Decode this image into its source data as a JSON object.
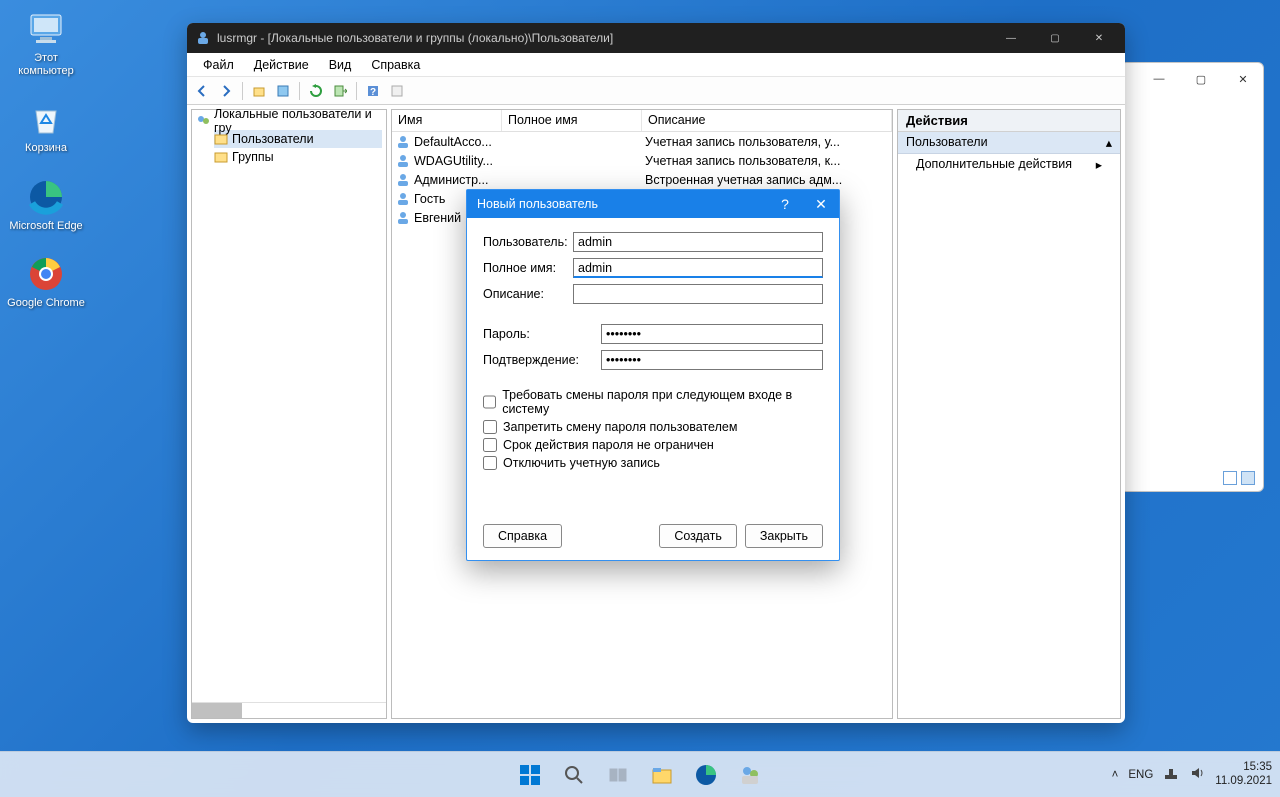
{
  "desktop": {
    "icons": [
      {
        "label": "Этот\nкомпьютер"
      },
      {
        "label": "Корзина"
      },
      {
        "label": "Microsoft\nEdge"
      },
      {
        "label": "Google\nChrome"
      }
    ]
  },
  "bgWindow": {
    "min": "—",
    "max": "▢",
    "close": "✕"
  },
  "mainWindow": {
    "title": "lusrmgr - [Локальные пользователи и группы (локально)\\Пользователи]",
    "menu": [
      "Файл",
      "Действие",
      "Вид",
      "Справка"
    ],
    "tree": {
      "root": "Локальные пользователи и гру",
      "children": [
        "Пользователи",
        "Группы"
      ]
    },
    "listHeaders": {
      "name": "Имя",
      "fullname": "Полное имя",
      "desc": "Описание"
    },
    "users": [
      {
        "name": "DefaultAcco...",
        "full": "",
        "desc": "Учетная запись пользователя, у..."
      },
      {
        "name": "WDAGUtility...",
        "full": "",
        "desc": "Учетная запись пользователя, к..."
      },
      {
        "name": "Администр...",
        "full": "",
        "desc": "Встроенная учетная запись адм..."
      },
      {
        "name": "Гость",
        "full": "",
        "desc": ""
      },
      {
        "name": "Евгений",
        "full": "",
        "desc": ""
      }
    ],
    "actions": {
      "header": "Действия",
      "group": "Пользователи",
      "item": "Дополнительные действия"
    }
  },
  "dialog": {
    "title": "Новый пользователь",
    "labels": {
      "user": "Пользователь:",
      "fullname": "Полное имя:",
      "desc": "Описание:",
      "password": "Пароль:",
      "confirm": "Подтверждение:"
    },
    "values": {
      "user": "admin",
      "fullname": "admin",
      "desc": "",
      "password": "••••••••",
      "confirm": "••••••••"
    },
    "checks": [
      "Требовать смены пароля при следующем входе в систему",
      "Запретить смену пароля пользователем",
      "Срок действия пароля не ограничен",
      "Отключить учетную запись"
    ],
    "buttons": {
      "help": "Справка",
      "create": "Создать",
      "close": "Закрыть"
    }
  },
  "taskbar": {
    "lang": "ENG",
    "time": "15:35",
    "date": "11.09.2021"
  }
}
